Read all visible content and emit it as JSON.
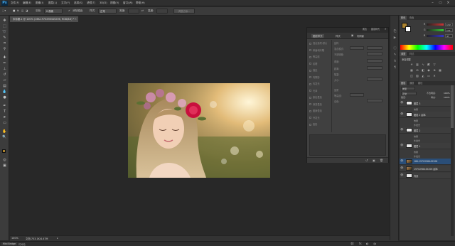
{
  "app": {
    "logo": "Ps"
  },
  "menubar": {
    "items": [
      "文件(F)",
      "编辑(E)",
      "图像(I)",
      "图层(L)",
      "文字(Y)",
      "选择(S)",
      "滤镜(T)",
      "3D(D)",
      "视图(V)",
      "窗口(W)",
      "帮助(H)"
    ],
    "window_controls": [
      "minimize-icon",
      "restore-icon",
      "close-icon"
    ]
  },
  "options": {
    "feather_label": "羽化:",
    "feather_value": "0 像素",
    "antialias_label": "消除锯齿",
    "style_label": "样式:",
    "style_value": "正常",
    "width_label": "宽度:",
    "height_label": "高度:",
    "refine_edge_button": "调整边缘..."
  },
  "document": {
    "tab_title": "未标题-1 @ 100% (16K-1970298445206, RGB/8#) *",
    "zoom": "100%",
    "doc_info": "文档:703.1K/4.47M"
  },
  "bottom_bar": {
    "tabs": [
      "Mini Bridge",
      "时间轴"
    ]
  },
  "properties": {
    "header_tabs": [
      "属性",
      "图层样式"
    ],
    "tabs": [
      "图层样式",
      "样式",
      "内阴影"
    ],
    "effects": [
      "混合选项:默认",
      "斜面和浮雕",
      "等高线",
      "纹理",
      "描边",
      "内阴影",
      "内发光",
      "光泽",
      "颜色叠加",
      "渐变叠加",
      "图案叠加",
      "外发光",
      "投影"
    ],
    "fields": [
      {
        "label": "结构"
      },
      {
        "label": "混合模式:"
      },
      {
        "label": "不透明度:"
      },
      {
        "label": "角度:"
      },
      {
        "label": "距离:"
      },
      {
        "label": "阻塞:"
      },
      {
        "label": "大小:"
      },
      {
        "label": "品质"
      },
      {
        "label": "等高线:"
      },
      {
        "label": "杂色:"
      }
    ]
  },
  "color_panel": {
    "tabs": [
      "颜色",
      "色板"
    ],
    "sliders": [
      {
        "label": "R",
        "value": "172",
        "color": "#c33"
      },
      {
        "label": "G",
        "value": "131",
        "color": "#3c3"
      },
      {
        "label": "B",
        "value": "47",
        "color": "#33c"
      }
    ],
    "foreground_color": "#ac832f",
    "background_color": "#ffffff"
  },
  "adjustments_panel": {
    "tabs": [
      "调整",
      "样式"
    ],
    "heading": "添加调整"
  },
  "layers_panel": {
    "tabs": [
      "图层",
      "通道",
      "路径"
    ],
    "kind_label": "类型",
    "blend_mode": "正常",
    "opacity_label": "不透明度:",
    "opacity_value": "100%",
    "lock_label": "锁定:",
    "fill_label": "填充:",
    "fill_value": "100%",
    "layers": [
      {
        "name": "图层 3",
        "thumb": "white",
        "selected": false
      },
      {
        "name": "效果",
        "fx": true
      },
      {
        "name": "图层 2 副本",
        "thumb": "white",
        "selected": false
      },
      {
        "name": "效果",
        "fx": true
      },
      {
        "name": "外发光",
        "fx": true
      },
      {
        "name": "图层 2",
        "thumb": "white",
        "selected": false
      },
      {
        "name": "效果",
        "fx": true
      },
      {
        "name": "外发光",
        "fx": true
      },
      {
        "name": "图层 1",
        "thumb": "white",
        "selected": false
      },
      {
        "name": "效果",
        "fx": true
      },
      {
        "name": "外发光",
        "fx": true
      },
      {
        "name": "16K-1970298445206",
        "thumb": "photo",
        "selected": true
      },
      {
        "name": "1970298445206 副本",
        "thumb": "photo",
        "selected": false
      },
      {
        "name": "背景",
        "thumb": "white",
        "selected": false
      }
    ]
  },
  "tools": [
    "move-tool",
    "marquee-tool",
    "lasso-tool",
    "quick-select-tool",
    "crop-tool",
    "eyedropper-tool",
    "healing-tool",
    "brush-tool",
    "clone-stamp-tool",
    "history-brush-tool",
    "eraser-tool",
    "gradient-tool",
    "blur-tool",
    "dodge-tool",
    "pen-tool",
    "type-tool",
    "path-select-tool",
    "shape-tool",
    "hand-tool",
    "zoom-tool"
  ]
}
